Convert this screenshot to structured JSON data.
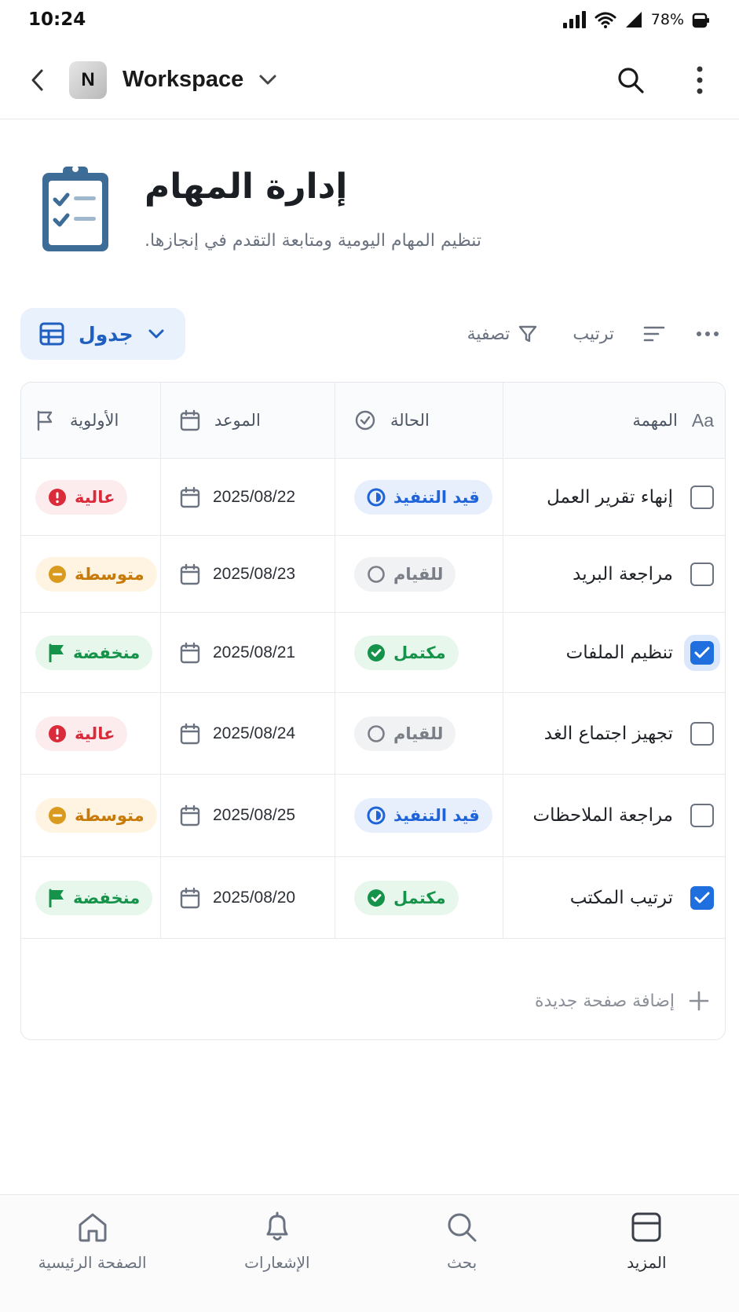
{
  "status_bar": {
    "time": "10:24",
    "battery": "78%"
  },
  "top_bar": {
    "workspace_initial": "N",
    "workspace_name": "Workspace"
  },
  "page": {
    "title": "إدارة المهام",
    "subtitle": "تنظيم المهام اليومية ومتابعة التقدم في إنجازها."
  },
  "toolbar": {
    "view_label": "جدول",
    "filter_label": "تصفية",
    "sort_label": "ترتيب"
  },
  "table": {
    "headers": {
      "task": "المهمة",
      "status": "الحالة",
      "date": "الموعد",
      "priority": "الأولوية"
    },
    "rows": [
      {
        "task": "إنهاء تقرير العمل",
        "checked": false,
        "status": "قيد التنفيذ",
        "status_type": "in-progress",
        "date": "2025/08/22",
        "priority": "عالية",
        "priority_type": "high"
      },
      {
        "task": "مراجعة البريد",
        "checked": false,
        "status": "للقيام",
        "status_type": "todo",
        "date": "2025/08/23",
        "priority": "متوسطة",
        "priority_type": "medium"
      },
      {
        "task": "تنظيم الملفات",
        "checked": true,
        "status": "مكتمل",
        "status_type": "done",
        "date": "2025/08/21",
        "priority": "منخفضة",
        "priority_type": "low"
      },
      {
        "task": "تجهيز اجتماع الغد",
        "checked": false,
        "status": "للقيام",
        "status_type": "todo",
        "date": "2025/08/24",
        "priority": "عالية",
        "priority_type": "high"
      },
      {
        "task": "مراجعة الملاحظات",
        "checked": false,
        "status": "قيد التنفيذ",
        "status_type": "in-progress",
        "date": "2025/08/25",
        "priority": "متوسطة",
        "priority_type": "medium"
      },
      {
        "task": "ترتيب المكتب",
        "checked": true,
        "status": "مكتمل",
        "status_type": "done",
        "date": "2025/08/20",
        "priority": "منخفضة",
        "priority_type": "low"
      }
    ],
    "add_label": "إضافة صفحة جديدة"
  },
  "bottom_nav": {
    "home": "الصفحة الرئيسية",
    "notifications": "الإشعارات",
    "search": "بحث",
    "more": "المزيد"
  },
  "colors": {
    "accent": "#1f6fde",
    "high": "#d92b3a",
    "medium": "#c87a08",
    "low": "#16934a",
    "in_progress": "#1f63d8",
    "todo": "#7a7f87"
  }
}
